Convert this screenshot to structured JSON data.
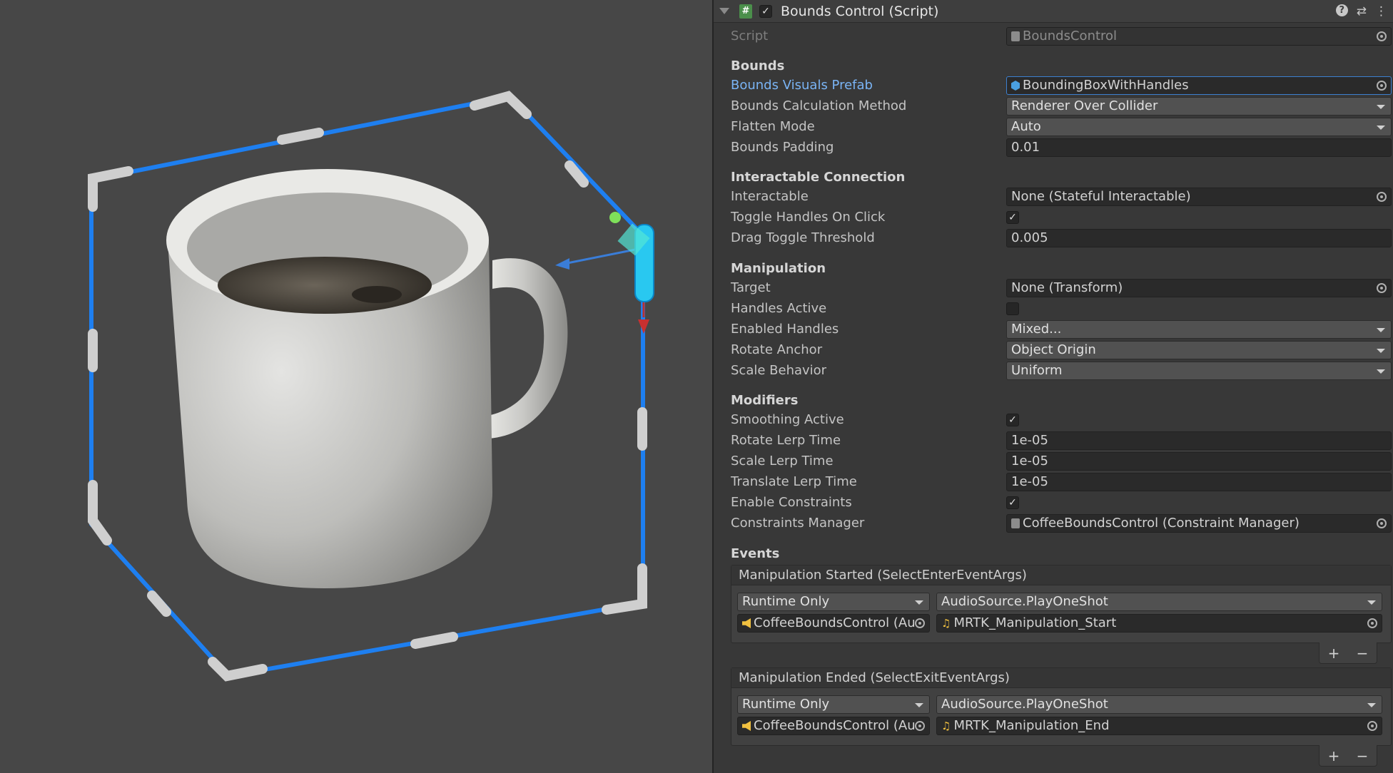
{
  "header": {
    "title": "Bounds Control (Script)",
    "script_icon": "#",
    "check": "✓"
  },
  "script": {
    "label": "Script",
    "value": "BoundsControl"
  },
  "bounds": {
    "section": "Bounds",
    "visuals_prefab": {
      "label": "Bounds Visuals Prefab",
      "value": "BoundingBoxWithHandles"
    },
    "calc_method": {
      "label": "Bounds Calculation Method",
      "value": "Renderer Over Collider"
    },
    "flatten_mode": {
      "label": "Flatten Mode",
      "value": "Auto"
    },
    "padding": {
      "label": "Bounds Padding",
      "value": "0.01"
    }
  },
  "interactable_connection": {
    "section": "Interactable Connection",
    "interactable": {
      "label": "Interactable",
      "value": "None (Stateful Interactable)"
    },
    "toggle_on_click": {
      "label": "Toggle Handles On Click",
      "checked": true
    },
    "drag_threshold": {
      "label": "Drag Toggle Threshold",
      "value": "0.005"
    }
  },
  "manipulation": {
    "section": "Manipulation",
    "target": {
      "label": "Target",
      "value": "None (Transform)"
    },
    "handles_active": {
      "label": "Handles Active",
      "checked": false
    },
    "enabled_handles": {
      "label": "Enabled Handles",
      "value": "Mixed..."
    },
    "rotate_anchor": {
      "label": "Rotate Anchor",
      "value": "Object Origin"
    },
    "scale_behavior": {
      "label": "Scale Behavior",
      "value": "Uniform"
    }
  },
  "modifiers": {
    "section": "Modifiers",
    "smoothing_active": {
      "label": "Smoothing Active",
      "checked": true
    },
    "rotate_lerp": {
      "label": "Rotate Lerp Time",
      "value": "1e-05"
    },
    "scale_lerp": {
      "label": "Scale Lerp Time",
      "value": "1e-05"
    },
    "translate_lerp": {
      "label": "Translate Lerp Time",
      "value": "1e-05"
    },
    "enable_constraints": {
      "label": "Enable Constraints",
      "checked": true
    },
    "constraints_manager": {
      "label": "Constraints Manager",
      "value": "CoffeeBoundsControl (Constraint Manager)"
    }
  },
  "events": {
    "section": "Events",
    "started": {
      "title": "Manipulation Started (SelectEnterEventArgs)",
      "mode": "Runtime Only",
      "function": "AudioSource.PlayOneShot",
      "object": "CoffeeBoundsControl (Au",
      "argument": "MRTK_Manipulation_Start"
    },
    "ended": {
      "title": "Manipulation Ended (SelectExitEventArgs)",
      "mode": "Runtime Only",
      "function": "AudioSource.PlayOneShot",
      "object": "CoffeeBoundsControl (Au",
      "argument": "MRTK_Manipulation_End"
    },
    "plus": "+",
    "minus": "−"
  },
  "colors": {
    "bounds_line": "#1e7ff0",
    "handle": "#cfcfcf",
    "link_label": "#7ab4f5"
  }
}
